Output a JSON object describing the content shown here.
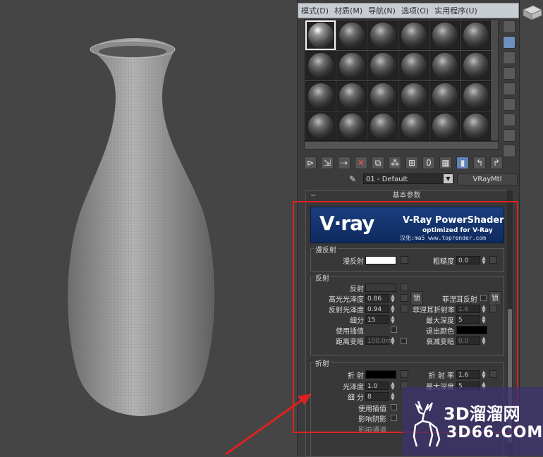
{
  "menu": [
    "模式(D)",
    "材质(M)",
    "导航(N)",
    "选项(O)",
    "实用程序(U)"
  ],
  "material": {
    "name": "01 - Default",
    "type": "VRayMtl"
  },
  "rollout_title": "基本参数",
  "banner": {
    "logo": "V·ray",
    "line1": "V-Ray PowerShader",
    "line2": "optimized for V-Ray",
    "credit": "汉化:ma5 www.toprender.com"
  },
  "diffuse": {
    "title": "漫反射",
    "label": "漫反射",
    "color": "#ffffff",
    "roughness_label": "粗糙度",
    "roughness": "0.0"
  },
  "reflection": {
    "title": "反射",
    "refl_label": "反射",
    "refl_color": "#3a3a3a",
    "hilight_label": "高光光泽度",
    "hilight": "0.86",
    "lock_label": "锁",
    "fresnel_label": "菲涅耳反射",
    "gloss_label": "反射光泽度",
    "gloss": "0.94",
    "fresnel_ior_label": "菲涅耳折射率",
    "fresnel_ior": "1.6",
    "subdivs_label": "细分",
    "subdivs": "15",
    "maxdepth_label": "最大深度",
    "maxdepth": "5",
    "interp_label": "使用插值",
    "exit_label": "退出颜色",
    "exit_color": "#000000",
    "dim_dist_label": "距离变暗",
    "dim_dist": "100.0m",
    "dim_falloff_label": "衰减变暗",
    "dim_falloff": "0.0"
  },
  "refraction": {
    "title": "折射",
    "refr_label": "折 射",
    "refr_color": "#000000",
    "ior_label": "折 射 率",
    "ior": "1.6",
    "gloss_label": "光泽度",
    "gloss": "1.0",
    "maxdepth_label": "最大深度",
    "maxdepth": "5",
    "subdivs_label": "细 分",
    "subdivs": "8",
    "interp_label": "使用插值",
    "shadows_label": "影响阴影",
    "cut_label": "影响通道"
  },
  "watermark": {
    "cn": "3D溜溜网",
    "en": "3D66.COM"
  },
  "colors": {
    "accent_red": "#e0211f",
    "panel": "#3c3c3c",
    "banner_blue": "#123266"
  }
}
